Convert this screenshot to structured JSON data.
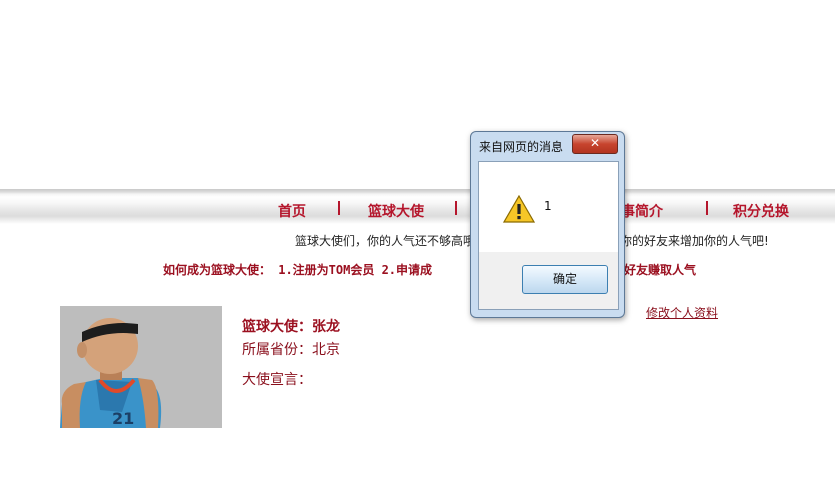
{
  "nav": {
    "items": [
      "首页",
      "篮球大使",
      "赛事简介",
      "积分兑换"
    ]
  },
  "notice": {
    "left": "篮球大使们，你的人气还不够高哦",
    "right": "你的好友来增加你的人气吧!"
  },
  "howto": {
    "left": "如何成为篮球大使： 1.注册为TOM会员 2.申请成",
    "right": "好友赚取人气"
  },
  "profile": {
    "edit_link": "修改个人资料",
    "title": "篮球大使：张龙",
    "province": "所属省份：北京",
    "declaration": "大使宣言："
  },
  "dialog": {
    "title": "来自网页的消息",
    "message": "1",
    "ok_label": "确定",
    "close_glyph": "✕"
  },
  "colors": {
    "brand_red": "#b5162c",
    "dialog_frame": "#c9dcf0",
    "avatar_bg": "#bdbdbd"
  },
  "icons": {
    "dialog_icon": "warning-icon",
    "avatar": "basketball-player-avatar"
  }
}
